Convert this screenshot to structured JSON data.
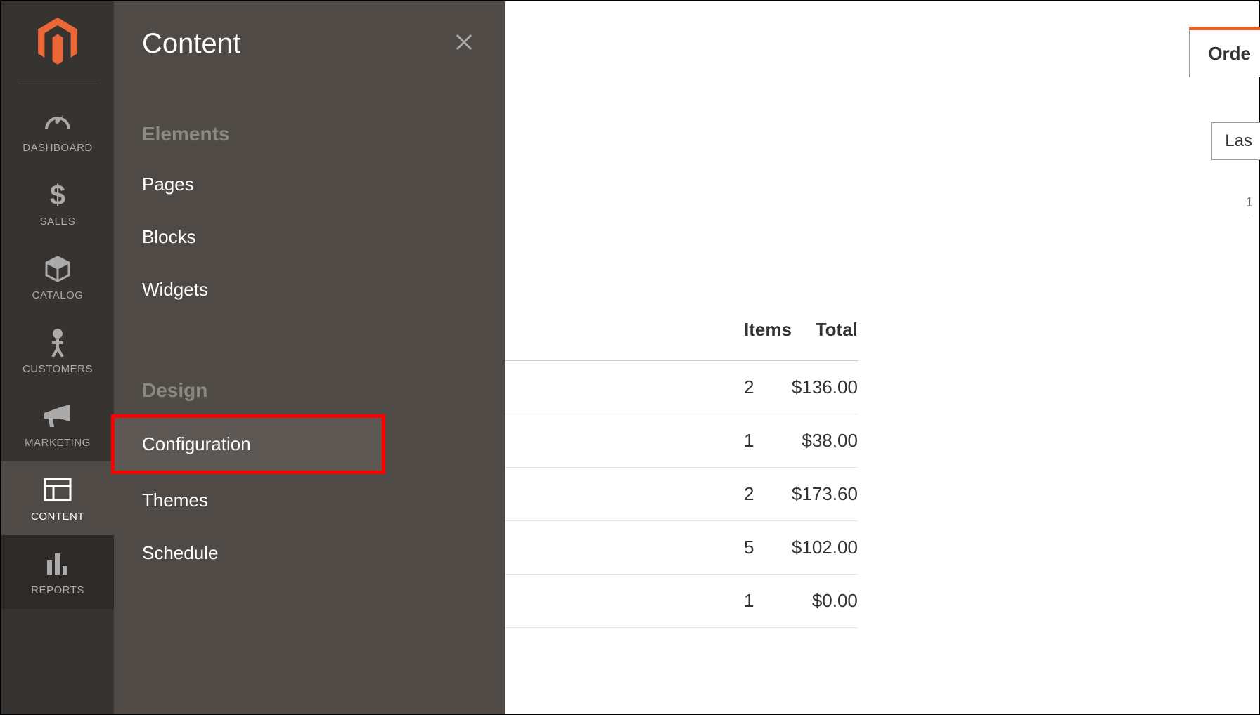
{
  "sidebar": {
    "items": [
      {
        "label": "DASHBOARD"
      },
      {
        "label": "SALES"
      },
      {
        "label": "CATALOG"
      },
      {
        "label": "CUSTOMERS"
      },
      {
        "label": "MARKETING"
      },
      {
        "label": "CONTENT"
      },
      {
        "label": "REPORTS"
      }
    ]
  },
  "flyout": {
    "title": "Content",
    "sections": {
      "elements": {
        "title": "Elements",
        "items": [
          "Pages",
          "Blocks",
          "Widgets"
        ]
      },
      "design": {
        "title": "Design",
        "items": [
          "Configuration",
          "Themes",
          "Schedule"
        ]
      }
    }
  },
  "tabs": {
    "orders": "Orde"
  },
  "filter": {
    "value": "Las"
  },
  "chart": {
    "tick1": "1"
  },
  "table": {
    "headers": {
      "items": "Items",
      "total": "Total"
    },
    "rows": [
      {
        "items": "2",
        "total": "$136.00"
      },
      {
        "items": "1",
        "total": "$38.00"
      },
      {
        "items": "2",
        "total": "$173.60"
      },
      {
        "items": "5",
        "total": "$102.00"
      },
      {
        "items": "1",
        "total": "$0.00"
      }
    ]
  }
}
